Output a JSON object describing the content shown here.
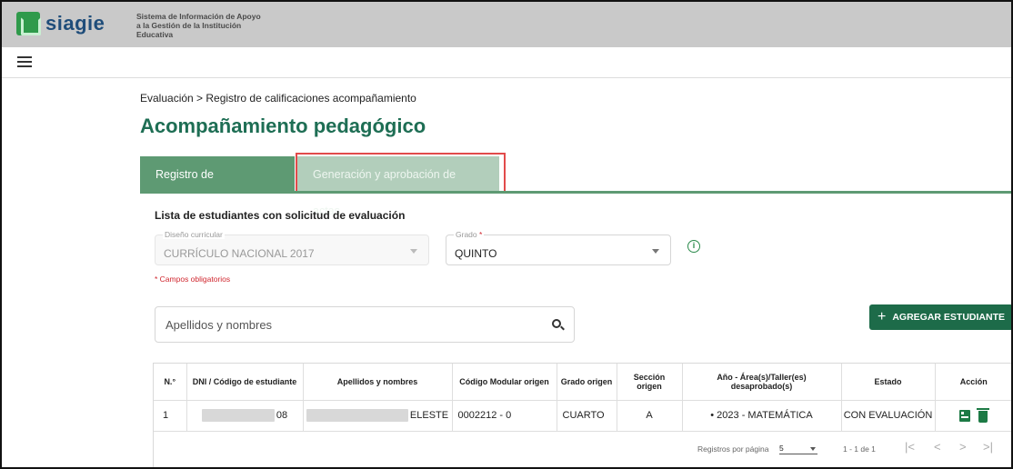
{
  "header": {
    "logo_text": "siagie",
    "subtitle": "Sistema de Información de Apoyo a la Gestión de la Institución Educativa"
  },
  "breadcrumb": "Evaluación > Registro de calificaciones acompañamiento",
  "page_title": "Acompañamiento pedagógico",
  "tabs": [
    {
      "label": "Registro de calificaciones",
      "active": true
    },
    {
      "label": "Generación y aprobación de actas",
      "active": false
    }
  ],
  "section_title": "Lista de estudiantes con solicitud de evaluación",
  "filters": {
    "curriculum": {
      "label": "Diseño curricular",
      "value": "CURRÍCULO NACIONAL 2017"
    },
    "grado": {
      "label": "Grado",
      "required_mark": "*",
      "value": "QUINTO"
    }
  },
  "required_note": "* Campos obligatorios",
  "search": {
    "placeholder": "Apellidos y nombres"
  },
  "add_button": "AGREGAR ESTUDIANTE",
  "table": {
    "columns": [
      "N.°",
      "DNI / Código de estudiante",
      "Apellidos y nombres",
      "Código Modular origen",
      "Grado origen",
      "Sección origen",
      "Año - Área(s)/Taller(es) desaprobado(s)",
      "Estado",
      "Acción"
    ],
    "rows": [
      {
        "n": "1",
        "dni_suffix": "08",
        "name_suffix": "ELESTE",
        "codigo_modular": "0002212 - 0",
        "grado": "CUARTO",
        "seccion": "A",
        "area": "• 2023 - MATEMÁTICA",
        "estado": "CON EVALUACIÓN"
      }
    ]
  },
  "pagination": {
    "rows_per_page_label": "Registros por página",
    "rows_per_page": "5",
    "range": "1 - 1 de 1",
    "first": "|<",
    "prev": "<",
    "next": ">",
    "last": ">|"
  },
  "colors": {
    "primary": "#1d6b49",
    "tab_active": "#5e9a73",
    "tab_inactive": "#b2cebb",
    "highlight": "#e24b4b"
  }
}
